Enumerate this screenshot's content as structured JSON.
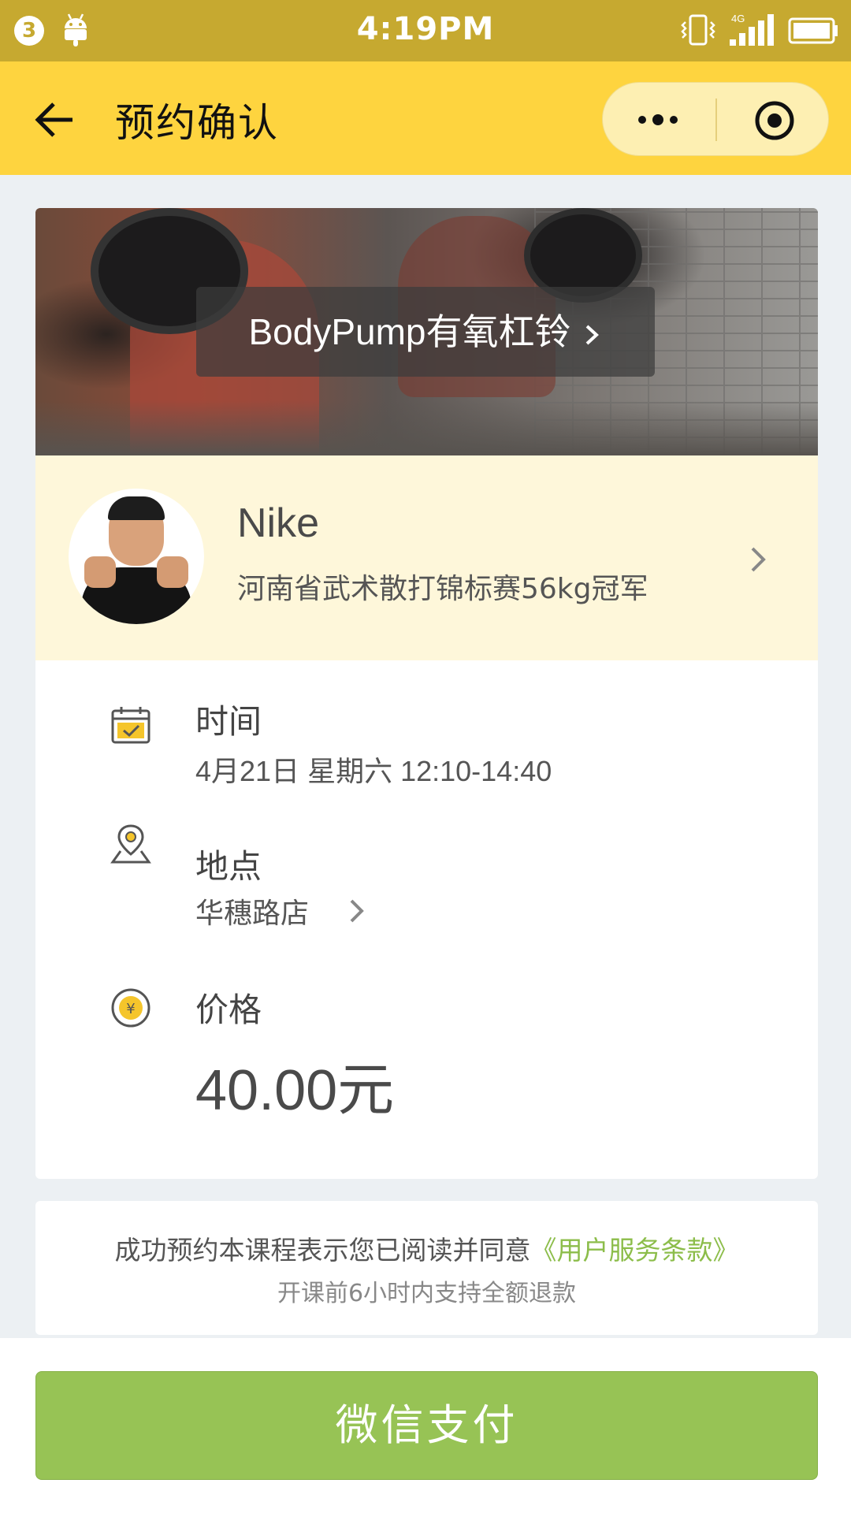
{
  "status_bar": {
    "notification_count": "3",
    "time": "4:19PM",
    "network_label": "4G",
    "icons": [
      "notification-badge",
      "android-icon",
      "vibrate-icon",
      "signal-icon",
      "battery-icon"
    ]
  },
  "nav": {
    "title": "预约确认",
    "back_icon": "arrow-left-icon",
    "more_icon": "more-dots-icon",
    "close_icon": "target-circle-icon"
  },
  "course": {
    "name": "BodyPump有氧杠铃",
    "chevron_icon": "chevron-right-icon"
  },
  "coach": {
    "name": "Nike",
    "description": "河南省武术散打锦标赛56kg冠军"
  },
  "details": {
    "time": {
      "label": "时间",
      "value": "4月21日 星期六 12:10-14:40",
      "icon": "calendar-icon"
    },
    "location": {
      "label": "地点",
      "value": "华穗路店",
      "icon": "map-pin-icon"
    },
    "price": {
      "label": "价格",
      "value": "40.00元",
      "icon": "yen-coin-icon"
    }
  },
  "notice": {
    "agreement_text": "成功预约本课程表示您已阅读并同意",
    "agreement_link": "《用户服务条款》",
    "refund_text": "开课前6小时内支持全额退款"
  },
  "pay_button": {
    "label": "微信支付"
  },
  "colors": {
    "status_bar": "#c6a930",
    "nav_bar": "#fed43f",
    "coach_bg": "#fef7da",
    "link": "#8cbd4a",
    "pay_button": "#97c355",
    "page_bg": "#ecf0f3"
  }
}
